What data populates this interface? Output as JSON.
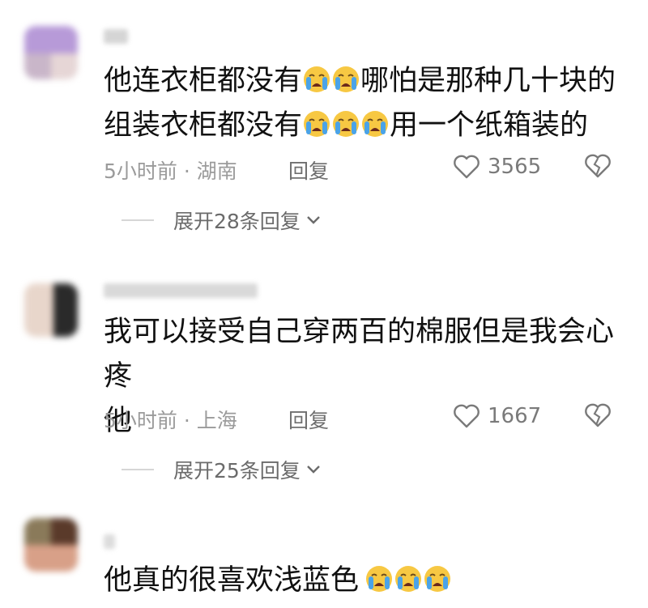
{
  "comments": [
    {
      "text_prefix": "他连衣柜都没有",
      "text_middle": "哪怕是那种几十块的",
      "text_line2_prefix": "组装衣柜都没有",
      "text_line2_suffix": "用一个纸箱装的",
      "time_location": "5小时前 · 湖南",
      "reply_label": "回复",
      "likes": "3565",
      "expand_label": "展开28条回复"
    },
    {
      "text_line1": "我可以接受自己穿两百的棉服但是我会心疼",
      "text_line2": "他",
      "time_location": "5小时前 · 上海",
      "reply_label": "回复",
      "likes": "1667",
      "expand_label": "展开25条回复"
    },
    {
      "text_prefix": "他真的很喜欢浅蓝色"
    }
  ],
  "icons": {
    "emoji": "loudly-crying-face",
    "like": "heart-outline-icon",
    "dislike": "broken-heart-icon",
    "chevron": "chevron-down-icon"
  },
  "colors": {
    "text": "#111111",
    "meta": "#9b9b9b",
    "emoji_face": "#f7c843",
    "emoji_tear": "#4aa3e8"
  }
}
